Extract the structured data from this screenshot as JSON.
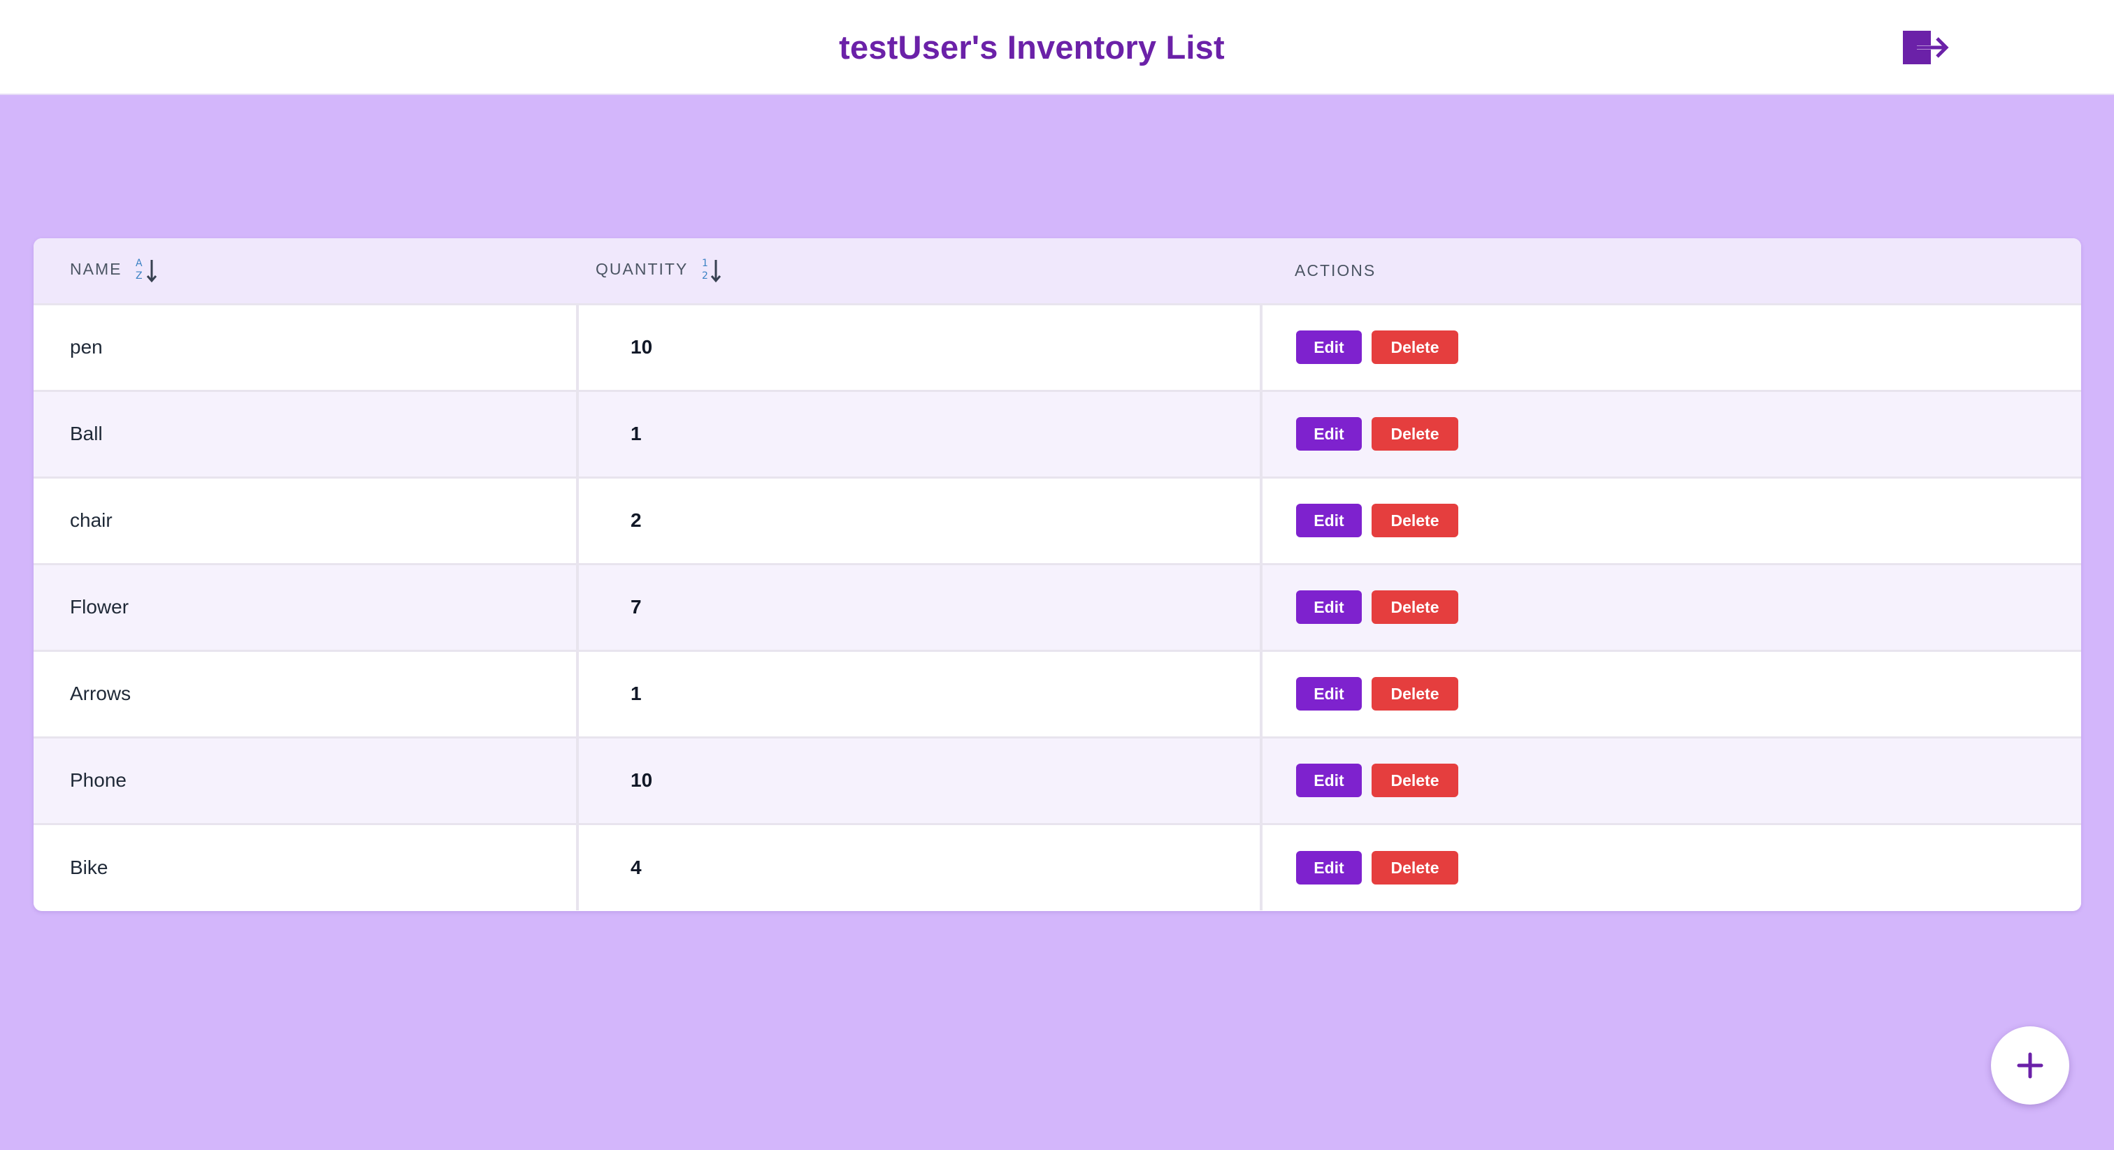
{
  "header": {
    "title": "testUser's Inventory List",
    "logout_icon": "logout-icon"
  },
  "table": {
    "columns": {
      "name": "NAME",
      "quantity": "QUANTITY",
      "actions": "ACTIONS"
    },
    "sort_icons": {
      "name": "sort-alpha-down-icon",
      "quantity": "sort-numeric-down-icon"
    },
    "edit_label": "Edit",
    "delete_label": "Delete",
    "rows": [
      {
        "name": "pen",
        "quantity": "10"
      },
      {
        "name": "Ball",
        "quantity": "1"
      },
      {
        "name": "chair",
        "quantity": "2"
      },
      {
        "name": "Flower",
        "quantity": "7"
      },
      {
        "name": "Arrows",
        "quantity": "1"
      },
      {
        "name": "Phone",
        "quantity": "10"
      },
      {
        "name": "Bike",
        "quantity": "4"
      }
    ]
  },
  "fab": {
    "icon": "plus-icon"
  },
  "colors": {
    "background": "#d3b6fb",
    "accent": "#6b21a8",
    "edit_button": "#7e22ce",
    "delete_button": "#e53e3e",
    "header_row": "#f0e8fc"
  }
}
